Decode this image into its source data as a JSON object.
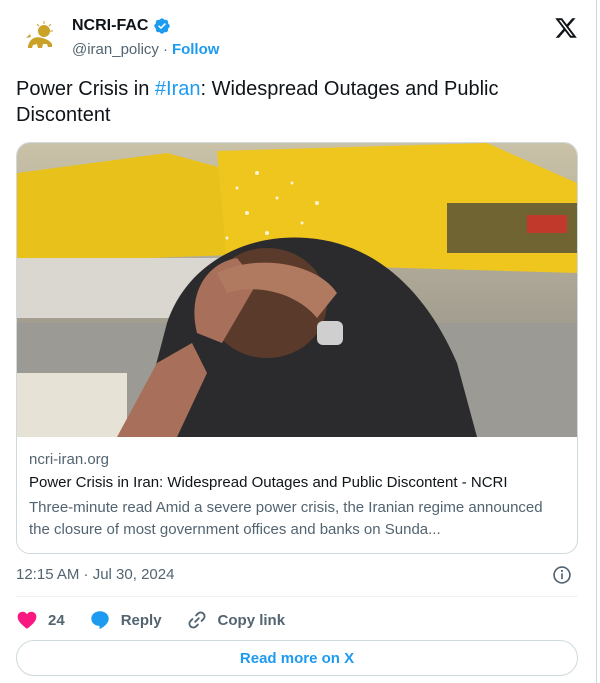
{
  "author": {
    "display_name": "NCRI-FAC",
    "handle": "@iran_policy",
    "separator": "·",
    "follow_label": "Follow",
    "verified": true
  },
  "tweet": {
    "text_before": "Power Crisis in ",
    "hashtag": "#Iran",
    "text_after": ": Widespread Outages and Public Discontent"
  },
  "link_card": {
    "domain": "ncri-iran.org",
    "title": "Power Crisis in Iran: Widespread Outages and Public Discontent - NCRI",
    "description": "Three-minute read Amid a severe power crisis, the Iranian regime announced the closure of most government offices and banks on Sunda..."
  },
  "timestamp": "12:15 AM · Jul 30, 2024",
  "actions": {
    "like_count": "24",
    "reply_label": "Reply",
    "copy_link_label": "Copy link"
  },
  "read_more_label": "Read more on X",
  "colors": {
    "accent": "#1d9bf0",
    "like_heart": "#f91880",
    "text_primary": "#0f1419",
    "text_secondary": "#536471"
  }
}
